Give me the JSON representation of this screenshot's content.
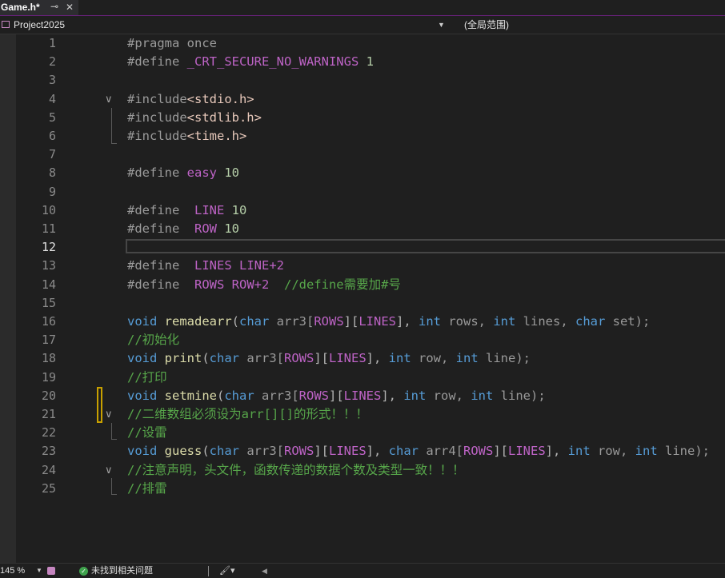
{
  "tab": {
    "title": "Game.h*",
    "pin": "⊸",
    "close": "✕"
  },
  "navbar": {
    "project": "Project2025",
    "scope": "(全局范围)",
    "dropdown": "▼"
  },
  "editor": {
    "lines": [
      {
        "n": "1"
      },
      {
        "n": "2"
      },
      {
        "n": "3"
      },
      {
        "n": "4"
      },
      {
        "n": "5"
      },
      {
        "n": "6"
      },
      {
        "n": "7"
      },
      {
        "n": "8"
      },
      {
        "n": "9"
      },
      {
        "n": "10"
      },
      {
        "n": "11"
      },
      {
        "n": "12"
      },
      {
        "n": "13"
      },
      {
        "n": "14"
      },
      {
        "n": "15"
      },
      {
        "n": "16"
      },
      {
        "n": "17"
      },
      {
        "n": "18"
      },
      {
        "n": "19"
      },
      {
        "n": "20"
      },
      {
        "n": "21"
      },
      {
        "n": "22"
      },
      {
        "n": "23"
      },
      {
        "n": "24"
      },
      {
        "n": "25"
      }
    ]
  },
  "code": {
    "l1": {
      "a": "#pragma once"
    },
    "l2": {
      "a": "#define ",
      "b": "_CRT_SECURE_NO_WARNINGS",
      "c": " ",
      "d": "1"
    },
    "l4": {
      "a": "#include",
      "b": "<stdio.h>"
    },
    "l5": {
      "a": "#include",
      "b": "<stdlib.h>"
    },
    "l6": {
      "a": "#include",
      "b": "<time.h>"
    },
    "l8": {
      "a": "#define ",
      "b": "easy",
      "c": " ",
      "d": "10"
    },
    "l10": {
      "a": "#define  ",
      "b": "LINE",
      "c": " ",
      "d": "10"
    },
    "l11": {
      "a": "#define  ",
      "b": "ROW",
      "c": " ",
      "d": "10"
    },
    "l13": {
      "a": "#define  ",
      "b": "LINES",
      "c": " LINE+2"
    },
    "l14": {
      "a": "#define  ",
      "b": "ROWS",
      "c": " ROW+2  ",
      "d": "//define需要加#号"
    },
    "l16": {
      "kw1": "void",
      "fn": " remadearr",
      "p1": "(",
      "kw2": "char",
      "t1": " arr3[",
      "m1": "ROWS",
      "t2": "][",
      "m2": "LINES",
      "t3": "], ",
      "kw3": "int",
      "t4": " rows, ",
      "kw4": "int",
      "t5": " lines, ",
      "kw5": "char",
      "t6": " set);"
    },
    "l17": {
      "cm": "//初始化"
    },
    "l18": {
      "kw1": "void",
      "fn": " print",
      "p1": "(",
      "kw2": "char",
      "t1": " arr3[",
      "m1": "ROWS",
      "t2": "][",
      "m2": "LINES",
      "t3": "], ",
      "kw3": "int",
      "t4": " row, ",
      "kw4": "int",
      "t5": " line);"
    },
    "l19": {
      "cm": "//打印"
    },
    "l20": {
      "kw1": "void",
      "fn": " setmine",
      "p1": "(",
      "kw2": "char",
      "t1": " arr3[",
      "m1": "ROWS",
      "t2": "][",
      "m2": "LINES",
      "t3": "], ",
      "kw3": "int",
      "t4": " row, ",
      "kw4": "int",
      "t5": " line);"
    },
    "l21": {
      "cm": "//二维数组必须设为arr[][]的形式！！！"
    },
    "l22": {
      "cm": "//设雷"
    },
    "l23": {
      "kw1": "void",
      "fn": " guess",
      "p1": "(",
      "kw2": "char",
      "t1": " arr3[",
      "m1": "ROWS",
      "t2": "][",
      "m2": "LINES",
      "t3": "], ",
      "kw3": "char",
      "t4": " arr4[",
      "m3": "ROWS",
      "t5": "][",
      "m4": "LINES",
      "t6": "], ",
      "kw4": "int",
      "t7": " row, ",
      "kw5": "int",
      "t8": " line);"
    },
    "l24": {
      "cm": "//注意声明，头文件，函数传递的数据个数及类型一致！！！"
    },
    "l25": {
      "cm": "//排雷"
    }
  },
  "folds": {
    "glyph": "∨"
  },
  "status": {
    "zoom": "145 %",
    "zoom_dd": "▼",
    "ok_glyph": "✓",
    "issues": "未找到相关问题",
    "brush": "🖌▾",
    "arrow": "◀"
  },
  "colors": {
    "accent": "#68217a",
    "keyword": "#569cd6",
    "function": "#dcdcaa",
    "comment": "#57a64a",
    "macro": "#bd63c5",
    "number": "#b5cea8"
  }
}
